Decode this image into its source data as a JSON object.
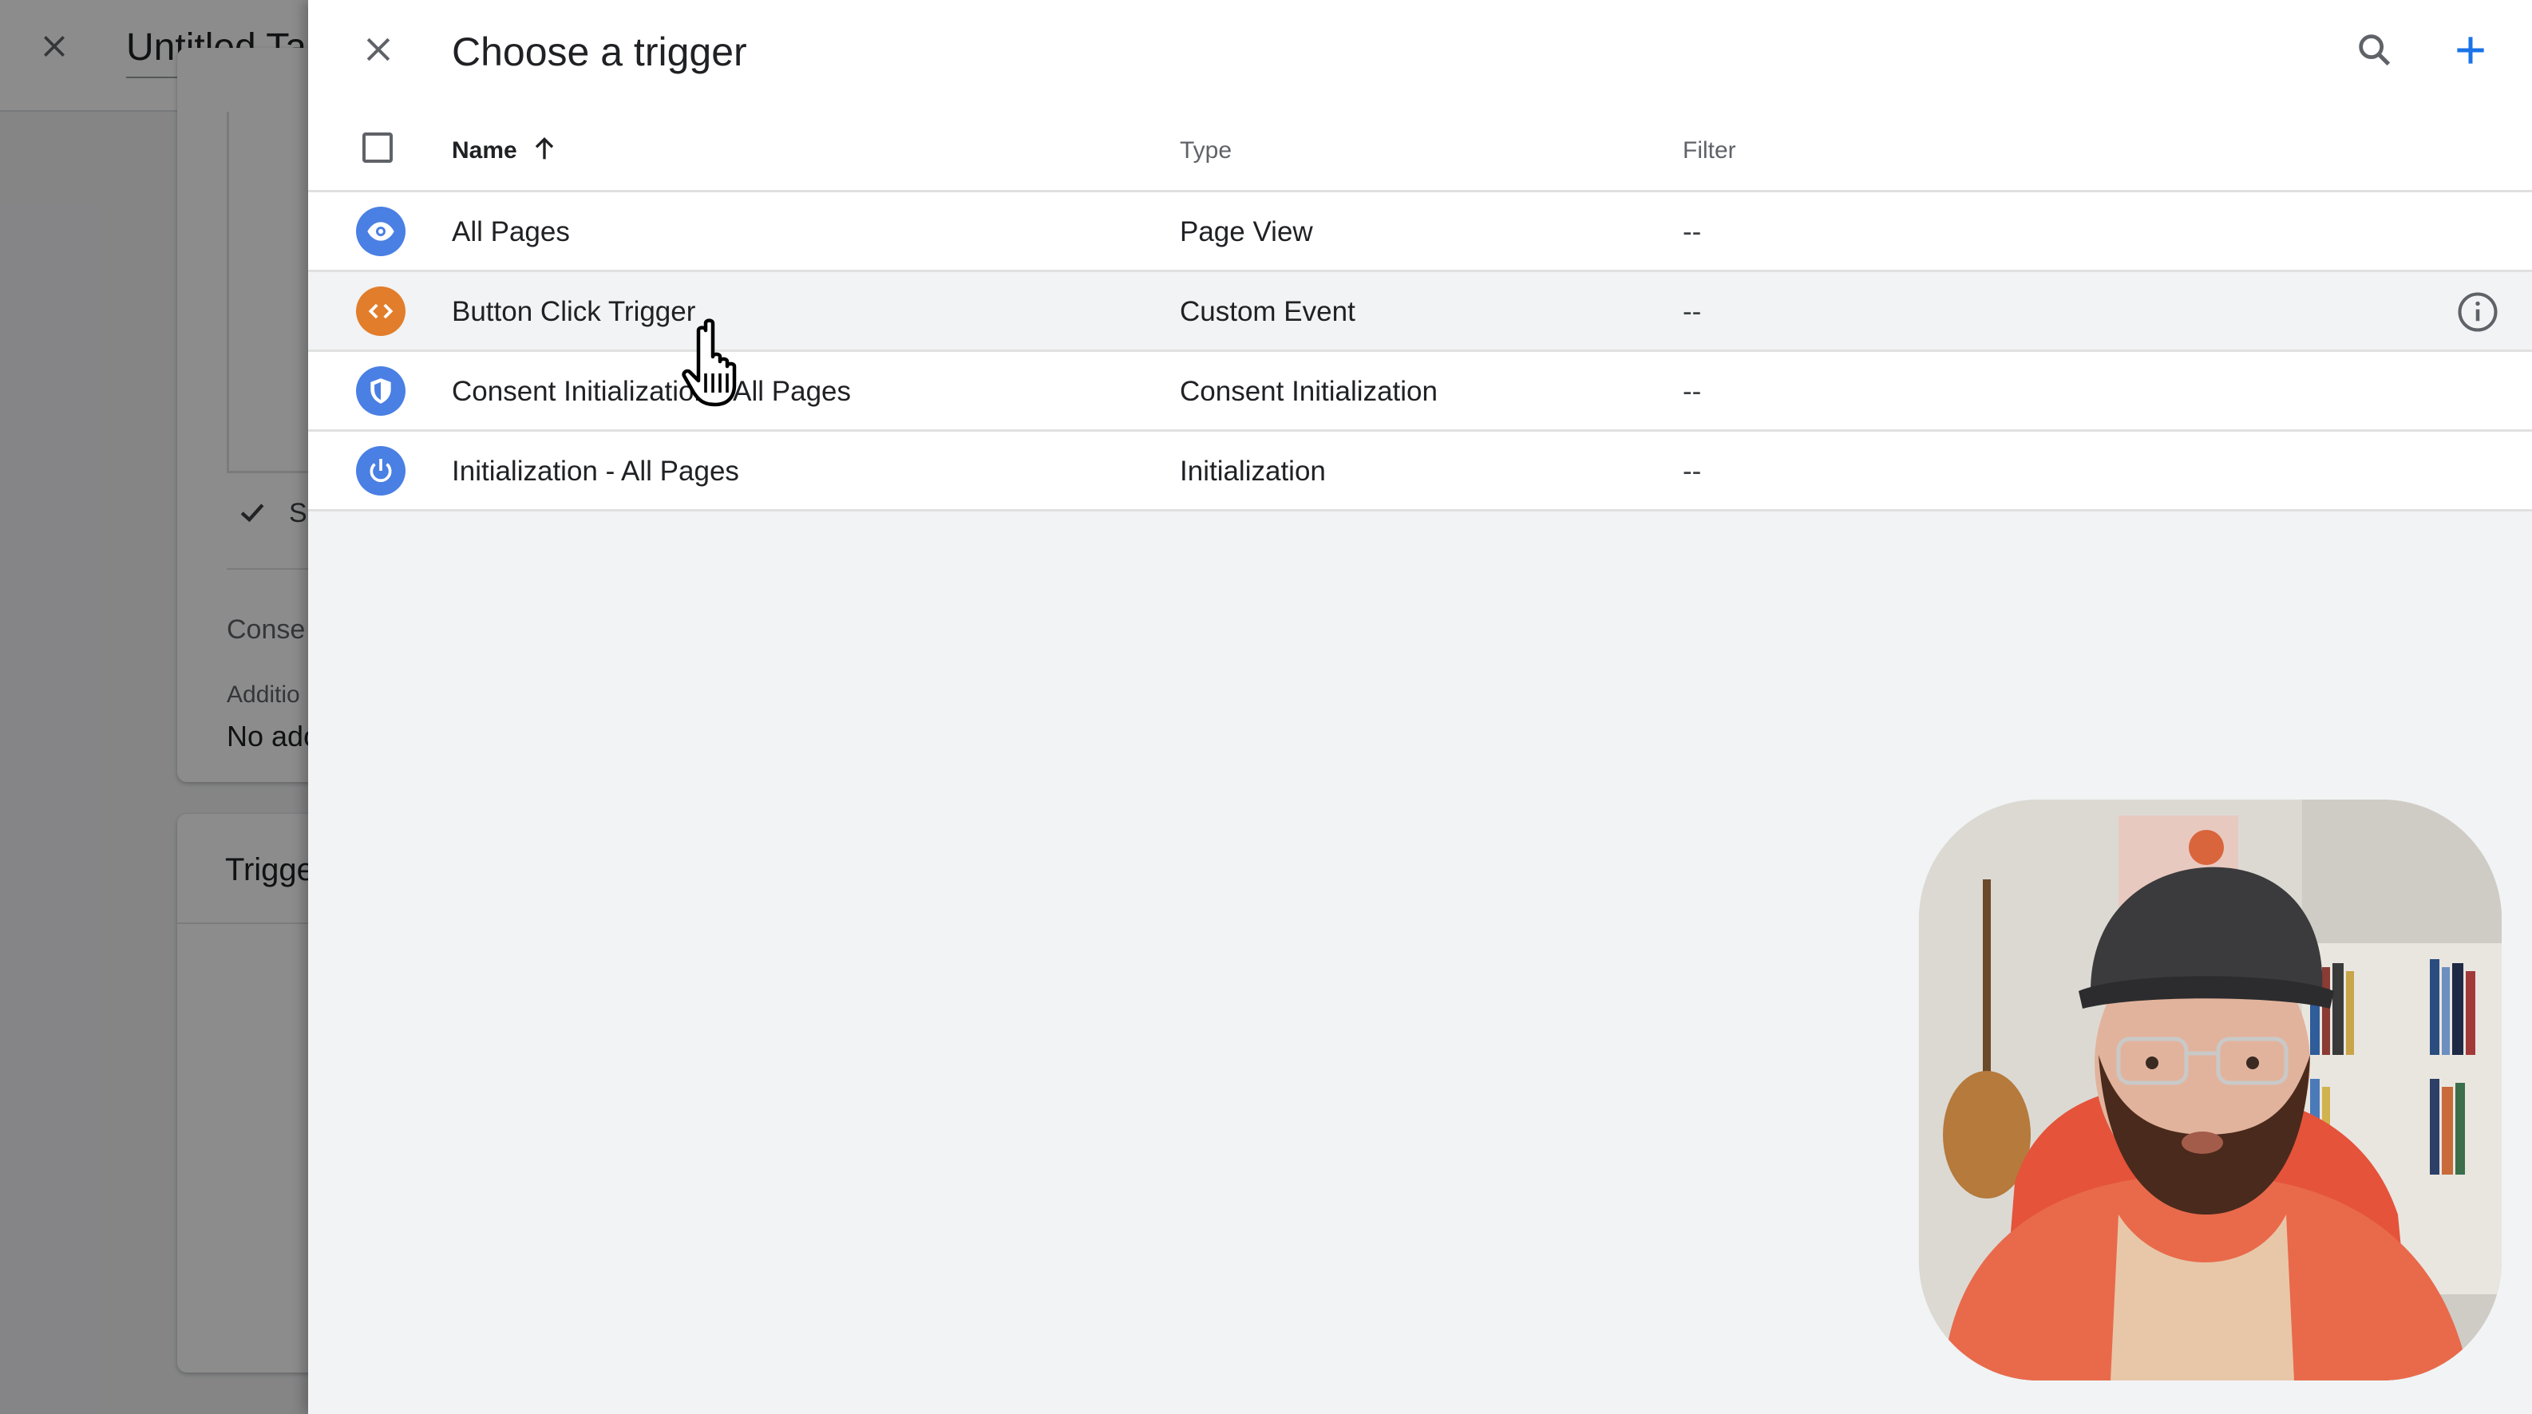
{
  "background": {
    "title": "Untitled Ta",
    "check_label": "S",
    "consent_label": "Conse",
    "additional_label": "Additio",
    "no_additional_text": "No ado",
    "triggering_title": "Trigge"
  },
  "panel": {
    "title": "Choose a trigger",
    "columns": {
      "name": "Name",
      "type": "Type",
      "filter": "Filter"
    },
    "rows": [
      {
        "icon": "eye-icon",
        "icon_color": "#4a7fe4",
        "name": "All Pages",
        "type": "Page View",
        "filter": "--"
      },
      {
        "icon": "code-brackets-icon",
        "icon_color": "#e27d2b",
        "name": "Button Click Trigger",
        "type": "Custom Event",
        "filter": "--"
      },
      {
        "icon": "shield-icon",
        "icon_color": "#4a7fe4",
        "name": "Consent Initialization - All Pages",
        "type": "Consent Initialization",
        "filter": "--"
      },
      {
        "icon": "power-icon",
        "icon_color": "#4a7fe4",
        "name": "Initialization - All Pages",
        "type": "Initialization",
        "filter": "--"
      }
    ]
  },
  "colors": {
    "accent_blue": "#1a73e8",
    "trigger_blue": "#4a7fe4",
    "trigger_orange": "#e27d2b"
  }
}
